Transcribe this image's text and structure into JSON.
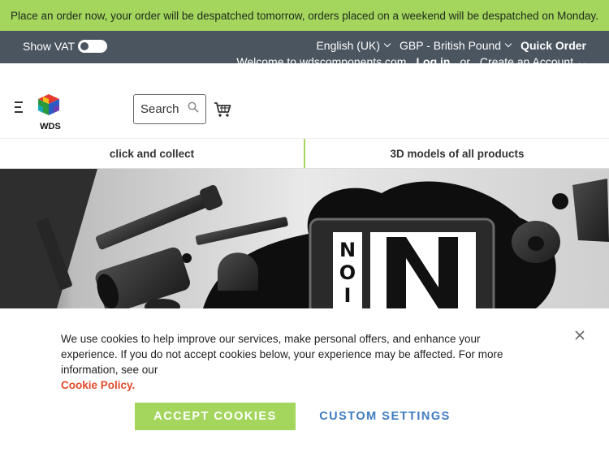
{
  "promo": {
    "text": "Place an order now, your order will be despatched tomorrow, orders placed on a weekend will be despatched on Monday."
  },
  "utility": {
    "vat_label": "Show VAT",
    "language": "English (UK)",
    "currency": "GBP - British Pound",
    "quick_order": "Quick Order",
    "welcome": "Welcome to wdscomponents.com",
    "login": "Log in",
    "or": "or",
    "create_account": "Create an Account"
  },
  "header": {
    "logo_text": "WDS",
    "search_placeholder": "Search"
  },
  "features": [
    {
      "label": "click and collect"
    },
    {
      "label": "3D models of all products"
    }
  ],
  "hero": {
    "sign_letters": "NOIR",
    "sign_big": "N"
  },
  "cookie": {
    "text": "We use cookies to help improve our services, make personal offers, and enhance your experience. If you do not accept cookies below, your experience may be affected. For more information, see our",
    "policy_link": "Cookie Policy.",
    "accept_label": "ACCEPT COOKIES",
    "custom_label": "CUSTOM SETTINGS"
  },
  "colors": {
    "accent_green": "#a4d65e",
    "utility_bg": "#4a5560",
    "link_red": "#e24a2b",
    "link_blue": "#3d7bbf"
  },
  "icons": {
    "search": "search-icon",
    "cart": "cart-icon",
    "close": "close-icon",
    "menu": "hamburger-menu-icon"
  }
}
